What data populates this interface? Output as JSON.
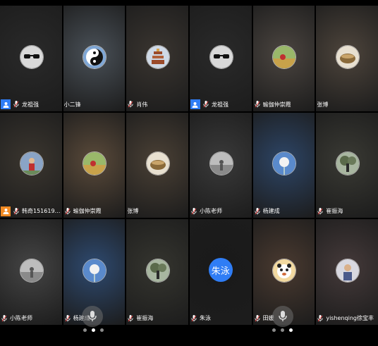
{
  "tiles": [
    {
      "name": "龙祖强",
      "badge": "blue",
      "mic": true,
      "avatar": "sunglasses-avatar",
      "bg": "#2a2a2a"
    },
    {
      "name": "小二锋",
      "badge": "",
      "mic": false,
      "avatar": "yin-yang-avatar",
      "bg": "#4a5158"
    },
    {
      "name": "肖伟",
      "badge": "",
      "mic": true,
      "avatar": "pagoda-avatar",
      "bg": "#3a3530"
    },
    {
      "name": "龙祖强",
      "badge": "blue",
      "mic": true,
      "avatar": "sunglasses-avatar",
      "bg": "#2a2a2a"
    },
    {
      "name": "瑜伽仲崇霞",
      "badge": "",
      "mic": true,
      "avatar": "field-avatar",
      "bg": "#4b4540"
    },
    {
      "name": "张博",
      "badge": "",
      "mic": false,
      "avatar": "bowl-avatar",
      "bg": "#4e453c"
    },
    {
      "name": "韩奇1516199...",
      "badge": "orange",
      "mic": true,
      "avatar": "person-avatar",
      "bg": "#3b362f"
    },
    {
      "name": "瑜伽仲崇霞",
      "badge": "",
      "mic": true,
      "avatar": "field-avatar",
      "bg": "#5a4a3a"
    },
    {
      "name": "张博",
      "badge": "",
      "mic": false,
      "avatar": "bowl-avatar",
      "bg": "#4a4035"
    },
    {
      "name": "小陈老师",
      "badge": "",
      "mic": true,
      "avatar": "gray-photo-avatar",
      "bg": "#3a3a3a"
    },
    {
      "name": "杨建成",
      "badge": "",
      "mic": true,
      "avatar": "dandelion-avatar",
      "bg": "#2d4566"
    },
    {
      "name": "崔振海",
      "badge": "",
      "mic": true,
      "avatar": "tree-avatar",
      "bg": "#3a3a34"
    },
    {
      "name": "小陈老师",
      "badge": "",
      "mic": true,
      "avatar": "gray-photo-avatar",
      "bg": "#454545"
    },
    {
      "name": "杨建成",
      "badge": "",
      "mic": true,
      "avatar": "dandelion-avatar",
      "bg": "#2e4a70"
    },
    {
      "name": "崔振海",
      "badge": "",
      "mic": true,
      "avatar": "tree-avatar",
      "bg": "#35352f"
    },
    {
      "name": "朱泳",
      "badge": "",
      "mic": true,
      "avatar": "text-avatar",
      "avatarText": "朱泳",
      "bg": "#1a1a1a"
    },
    {
      "name": "田媛",
      "badge": "",
      "mic": true,
      "avatar": "cartoon-avatar",
      "bg": "#4a3a30"
    },
    {
      "name": "yishenqing徐宝丰",
      "badge": "",
      "mic": true,
      "avatar": "portrait-avatar",
      "bg": "#453a3a"
    }
  ],
  "pagers": [
    {
      "count": 3,
      "active": 1
    },
    {
      "count": 3,
      "active": 2
    }
  ],
  "colors": {
    "accent": "#2f7df5",
    "host": "#f08a24"
  }
}
